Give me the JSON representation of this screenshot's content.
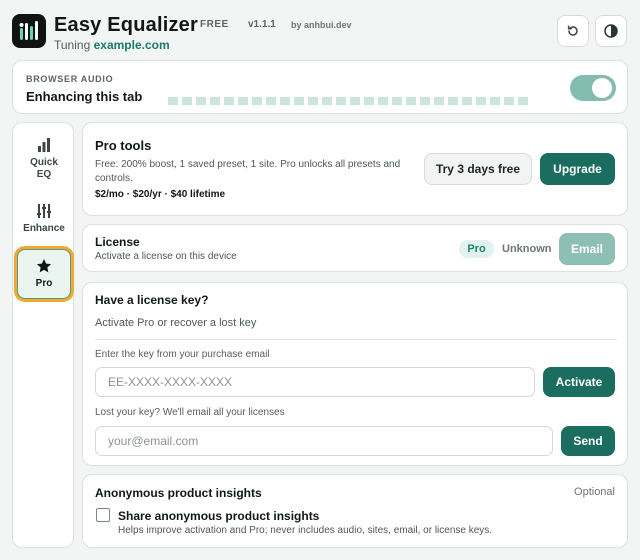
{
  "header": {
    "app_title": "Easy Equalizer",
    "plan_badge": "FREE",
    "version": "v1.1.1",
    "author": "by anhbui.dev",
    "tuning_prefix": "Tuning",
    "tuning_site": "example.com",
    "icons": [
      "reset-icon",
      "contrast-icon"
    ]
  },
  "audio": {
    "caption": "BROWSER AUDIO",
    "status": "Enhancing this tab",
    "enabled": true,
    "meter_segments": 26
  },
  "sidebar": {
    "items": [
      {
        "label": "Quick EQ",
        "icon": "bar-chart-icon",
        "active": false
      },
      {
        "label": "Enhance",
        "icon": "sliders-icon",
        "active": false
      },
      {
        "label": "Pro",
        "icon": "star-icon",
        "active": true
      }
    ]
  },
  "pro_tools": {
    "title": "Pro tools",
    "description": "Free: 200% boost, 1 saved preset, 1 site. Pro unlocks all presets and controls.",
    "pricing": "$2/mo · $20/yr · $40 lifetime",
    "trial_button": "Try 3 days free",
    "upgrade_button": "Upgrade"
  },
  "license": {
    "title": "License",
    "subtitle": "Activate a license on this device",
    "plan_pill": "Pro",
    "status": "Unknown",
    "email_button": "Email"
  },
  "license_key": {
    "title": "Have a license key?",
    "subtitle": "Activate Pro or recover a lost key",
    "key_label": "Enter the key from your purchase email",
    "key_placeholder": "EE-XXXX-XXXX-XXXX",
    "activate_button": "Activate",
    "lost_label": "Lost your key? We'll email all your licenses",
    "email_placeholder": "your@email.com",
    "send_button": "Send"
  },
  "insights": {
    "title": "Anonymous product insights",
    "optional": "Optional",
    "checkbox_label": "Share anonymous product insights",
    "checkbox_checked": false,
    "help": "Helps improve activation and Pro; never includes audio, sites, email, or license keys."
  },
  "colors": {
    "accent": "#1b6e5f",
    "accent_light": "#8ebfb4",
    "highlight": "#f4a92a",
    "background": "#f3f5f4"
  }
}
